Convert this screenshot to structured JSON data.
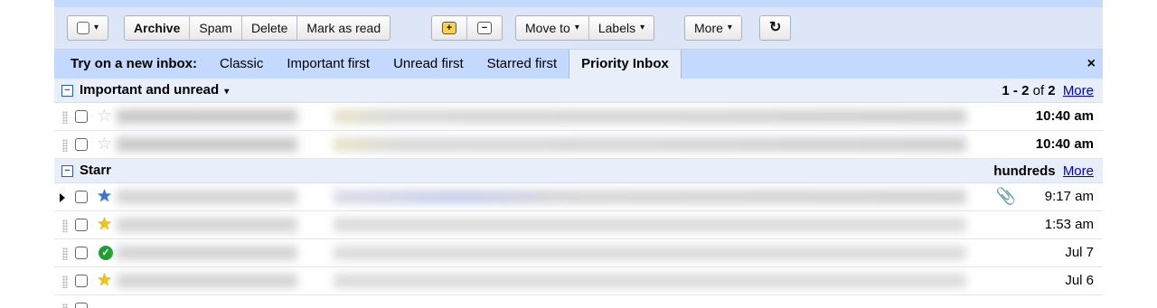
{
  "toolbar": {
    "select_caret": "▾",
    "archive": "Archive",
    "spam": "Spam",
    "delete": "Delete",
    "mark_as_read": "Mark as read",
    "important_plus": "+",
    "important_minus": "−",
    "move_to": "Move to",
    "labels": "Labels",
    "more": "More",
    "caret": "▾",
    "refresh": "↻"
  },
  "trybar": {
    "title": "Try on a new inbox:",
    "options": [
      "Classic",
      "Important first",
      "Unread first",
      "Starred first",
      "Priority Inbox"
    ],
    "active_index": 4,
    "close": "×"
  },
  "sections": {
    "important": {
      "toggle": "−",
      "title": "Important and unread",
      "caret": "▾",
      "count_range": "1 - 2",
      "count_of": "of",
      "count_total": "2",
      "more_link": "More"
    },
    "starred": {
      "toggle": "−",
      "title": "Starr",
      "count_text": "hundreds",
      "more_link": "More"
    }
  },
  "rows_important": [
    {
      "date": "10:40 am",
      "star": "☆",
      "unread": true
    },
    {
      "date": "10:40 am",
      "star": "☆",
      "unread": true
    }
  ],
  "rows_starred": [
    {
      "date": "9:17 am",
      "star": "★",
      "star_color": "#3a73d8",
      "attachment": "📎"
    },
    {
      "date": "1:53 am",
      "star": "★",
      "star_color": "#f1c40f"
    },
    {
      "date": "Jul 7",
      "check": "✓",
      "check_color": "#1e9e2f"
    },
    {
      "date": "Jul 6",
      "star": "★",
      "star_color": "#f1c40f"
    }
  ],
  "colors": {
    "toolbar_bg": "#dde6f6",
    "trybar_bg": "#c3d9ff",
    "section_bg": "#e8eefa",
    "link": "#0000cc"
  }
}
